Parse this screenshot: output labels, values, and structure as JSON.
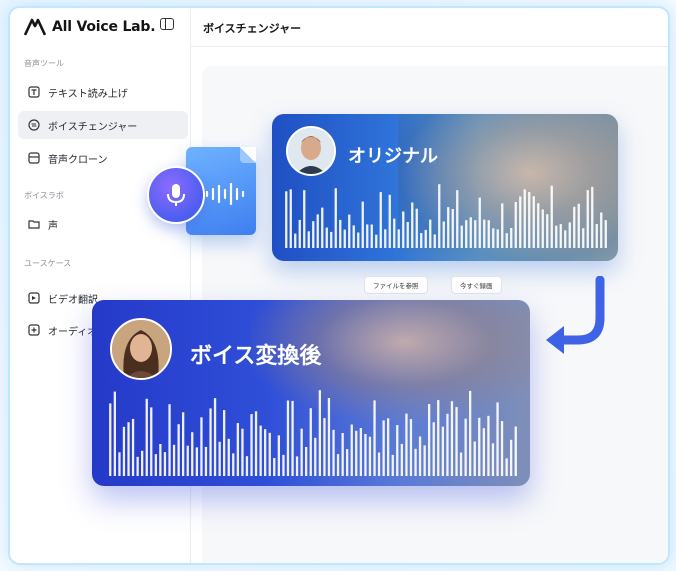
{
  "brand": {
    "name": "All Voice Lab."
  },
  "header": {
    "title": "ボイスチェンジャー"
  },
  "sidebar": {
    "sections": [
      {
        "label": "音声ツール"
      },
      {
        "label": "ボイスラボ"
      },
      {
        "label": "ユースケース"
      }
    ],
    "items": [
      {
        "label": "テキスト読み上げ",
        "icon": "text-to-speech-icon"
      },
      {
        "label": "ボイスチェンジャー",
        "icon": "voice-changer-icon",
        "active": true
      },
      {
        "label": "音声クローン",
        "icon": "voice-clone-icon"
      },
      {
        "label": "声",
        "icon": "voice-folder-icon"
      },
      {
        "label": "ビデオ翻訳",
        "icon": "video-translate-icon"
      },
      {
        "label": "オーディオ",
        "icon": "audio-icon"
      }
    ]
  },
  "cards": {
    "original": {
      "title": "オリジナル"
    },
    "converted": {
      "title": "ボイス変換後"
    }
  },
  "actions": {
    "browse_file": "ファイルを参照",
    "record_now": "今すぐ録画"
  },
  "colors": {
    "accent": "#2f5fe0",
    "card_gradient_start": "#1f4fc4",
    "frame_border": "#bfe8ff"
  }
}
